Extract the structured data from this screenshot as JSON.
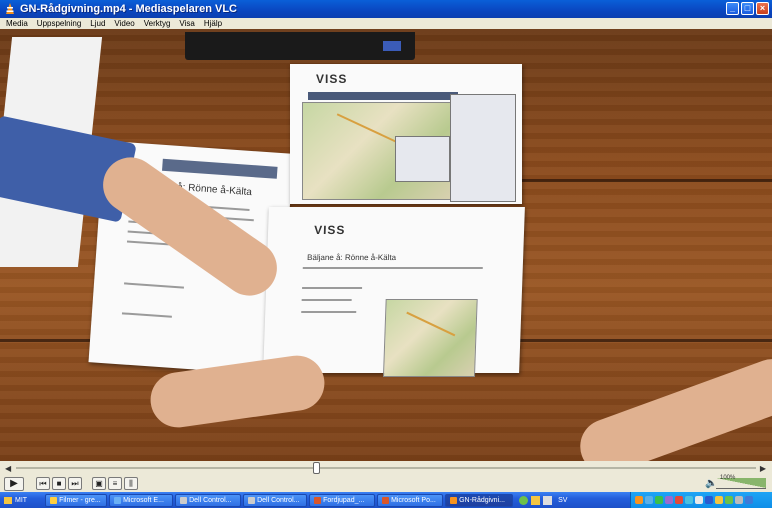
{
  "window": {
    "title": "GN-Rådgivning.mp4 - Mediaspelaren VLC"
  },
  "menu": [
    "Media",
    "Uppspelning",
    "Ljud",
    "Video",
    "Verktyg",
    "Visa",
    "Hjälp"
  ],
  "video": {
    "doc_logo_top": "VISS",
    "doc_logo_bottom": "VISS",
    "doc_left_title": "Bäljane å: Rönne å-Kälta",
    "doc_bottom_title": "Bäljane å: Rönne å-Kälta"
  },
  "controls": {
    "seek_back": "◀",
    "seek_forward": "▶",
    "seek_position": 0.405,
    "play_symbol": "▶",
    "volume_percent": "100%"
  },
  "taskbar": {
    "start_label": "MIT",
    "tasks": [
      {
        "label": "Filmer - gre..."
      },
      {
        "label": "Microsoft E..."
      },
      {
        "label": "Dell Control..."
      },
      {
        "label": "Dell Control..."
      },
      {
        "label": "Fordjupad_..."
      },
      {
        "label": "Microsoft Po..."
      },
      {
        "label": "GN-Rådgivni..."
      }
    ],
    "language": "SV"
  }
}
